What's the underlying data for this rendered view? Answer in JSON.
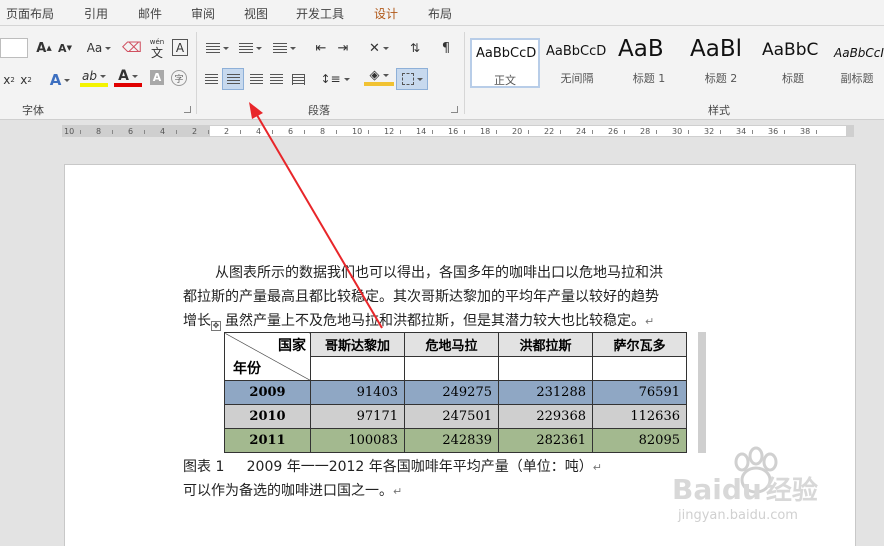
{
  "tabs": [
    {
      "label": "页面布局",
      "active": false
    },
    {
      "label": "引用",
      "active": false
    },
    {
      "label": "邮件",
      "active": false
    },
    {
      "label": "审阅",
      "active": false
    },
    {
      "label": "视图",
      "active": false
    },
    {
      "label": "开发工具",
      "active": false
    },
    {
      "label": "设计",
      "active": true
    },
    {
      "label": "布局",
      "active": false
    }
  ],
  "ribbon": {
    "font_group_label": "字体",
    "paragraph_group_label": "段落",
    "styles_group_label": "样式",
    "font_size_grow": "A",
    "font_size_shrink": "A",
    "change_case": "Aa",
    "pinyin_top": "wén",
    "pinyin_bottom": "文",
    "char_border": "A",
    "subscript": "x",
    "superscript": "x",
    "subscript_mark": "2",
    "superscript_mark": "2",
    "text_effect": "A",
    "highlight": "ab",
    "font_color": "A",
    "char_shading": "A",
    "enclose_char": "字",
    "styles": [
      {
        "sample": "AaBbCcD",
        "name": "正文",
        "selected": true
      },
      {
        "sample": "AaBbCcD",
        "name": "无间隔",
        "selected": false
      },
      {
        "sample": "AaB",
        "name": "标题 1",
        "selected": false
      },
      {
        "sample": "AaBl",
        "name": "标题 2",
        "selected": false
      },
      {
        "sample": "AaBbC",
        "name": "标题",
        "selected": false
      },
      {
        "sample": "AaBbCcI",
        "name": "副标题",
        "selected": false
      }
    ]
  },
  "ruler": {
    "numbers": [
      "10",
      "8",
      "6",
      "4",
      "2",
      "2",
      "4",
      "6",
      "8",
      "10",
      "12",
      "14",
      "16",
      "18",
      "20",
      "22",
      "24",
      "26",
      "28",
      "30",
      "32",
      "34",
      "36",
      "38"
    ]
  },
  "document": {
    "paragraph_lines": [
      "从图表所示的数据我们也可以得出，各国多年的咖啡出口以危地马拉和洪",
      "都拉斯的产量最高且都比较稳定。其次哥斯达黎加的平均年产量以较好的趋势",
      "增长，虽然产量上不及危地马拉和洪都拉斯，但是其潜力较大也比较稳定。"
    ],
    "return_mark": "↵",
    "table": {
      "corner_top": "国家",
      "corner_bottom": "年份",
      "headers": [
        "哥斯达黎加",
        "危地马拉",
        "洪都拉斯",
        "萨尔瓦多"
      ],
      "rows": [
        {
          "year": "2009",
          "values": [
            "91403",
            "249275",
            "231288",
            "76591"
          ]
        },
        {
          "year": "2010",
          "values": [
            "97171",
            "247501",
            "229368",
            "112636"
          ]
        },
        {
          "year": "2011",
          "values": [
            "100083",
            "242839",
            "282361",
            "82095"
          ]
        }
      ]
    },
    "caption_label": "图表 1",
    "caption_text": "2009 年一一2012 年各国咖啡年平均产量（单位：吨）",
    "final_line": "可以作为备选的咖啡进口国之一。"
  },
  "watermark": {
    "brand": "Baidu",
    "brand_suffix": "经验",
    "url": "jingyan.baidu.com"
  },
  "colors": {
    "active_tab": "#b05818",
    "arrow": "#e8262a",
    "row_2009": "#8fa7c4",
    "row_2010": "#cfcfcf",
    "row_2011": "#a3b98f"
  }
}
